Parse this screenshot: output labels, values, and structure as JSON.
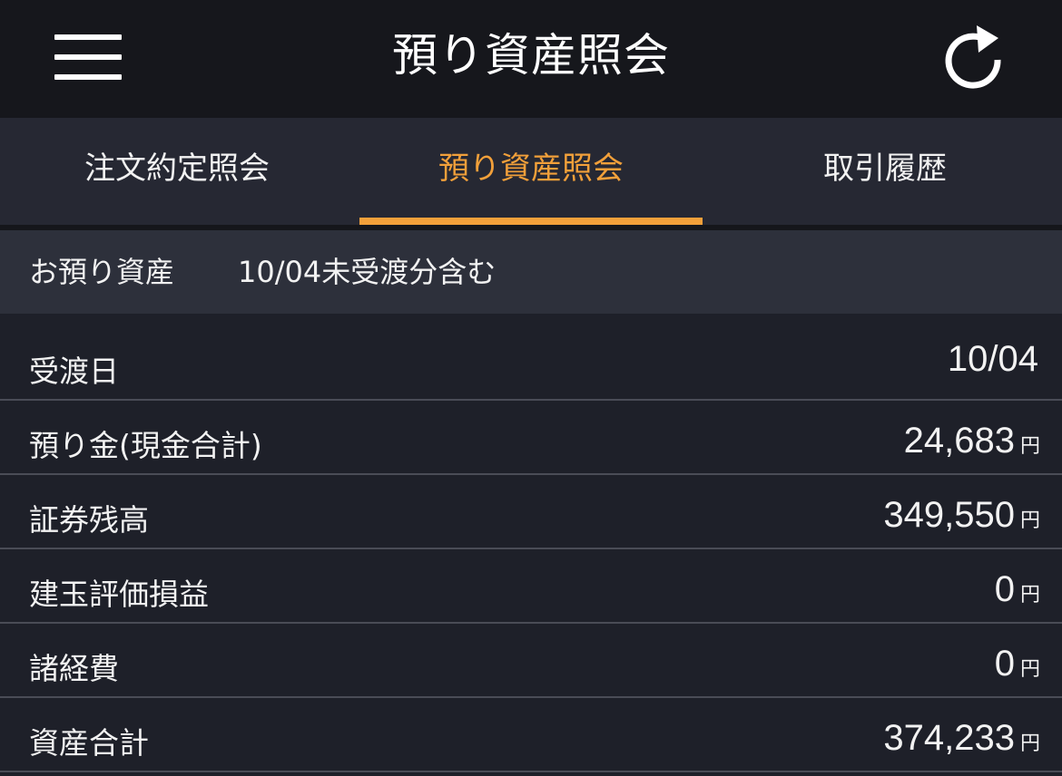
{
  "header": {
    "title": "預り資産照会",
    "menu_icon": "hamburger-menu-icon",
    "refresh_icon": "refresh-icon"
  },
  "tabs": [
    {
      "label": "注文約定照会",
      "active": false
    },
    {
      "label": "預り資産照会",
      "active": true
    },
    {
      "label": "取引履歴",
      "active": false
    }
  ],
  "section": {
    "title": "お預り資産",
    "note": "10/04未受渡分含む"
  },
  "rows": [
    {
      "label": "受渡日",
      "value": "10/04",
      "unit": ""
    },
    {
      "label": "預り金(現金合計)",
      "value": "24,683",
      "unit": "円"
    },
    {
      "label": "証券残高",
      "value": "349,550",
      "unit": "円"
    },
    {
      "label": "建玉評価損益",
      "value": "0",
      "unit": "円"
    },
    {
      "label": "諸経費",
      "value": "0",
      "unit": "円"
    },
    {
      "label": "資産合計",
      "value": "374,233",
      "unit": "円"
    }
  ],
  "colors": {
    "accent": "#f2a03a",
    "header_bg": "#16171c",
    "tab_bg": "#262833",
    "section_bg": "#2d303b",
    "body_bg": "#1e2029"
  }
}
